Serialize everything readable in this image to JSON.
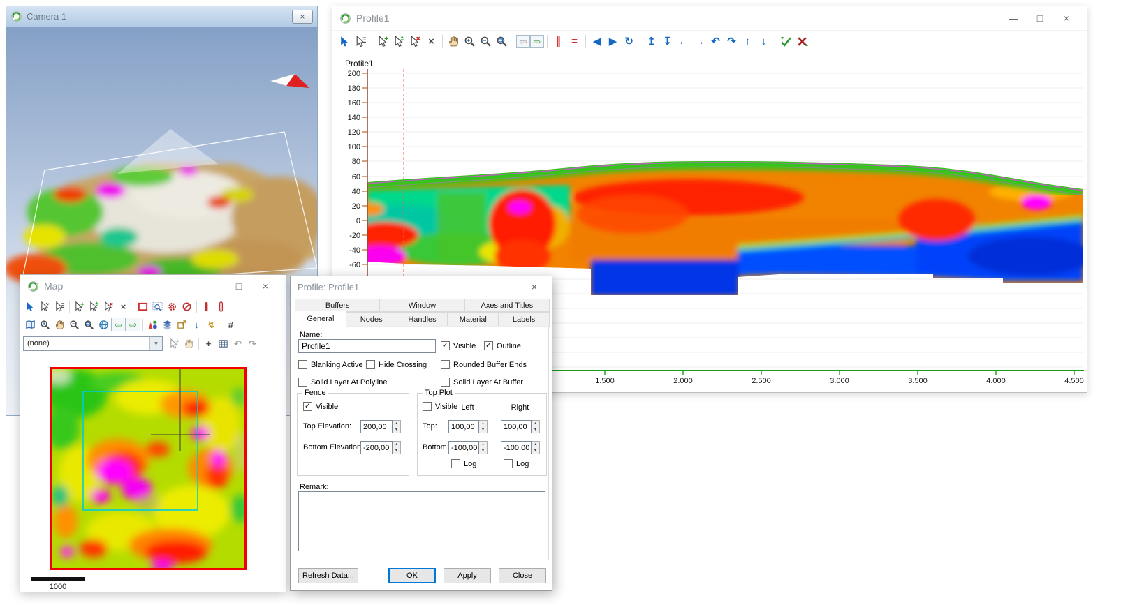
{
  "glyphs": {
    "minimize": "—",
    "maximize": "□",
    "close": "×",
    "check": "✓",
    "dropdown": "▾",
    "spin_up": "▴",
    "spin_down": "▾",
    "arrow_left": "←",
    "arrow_right": "→",
    "arrow_up": "↑",
    "arrow_down": "↓",
    "arrow_top": "↥",
    "arrow_bottom": "↧",
    "undo": "↶",
    "redo": "↷",
    "nav_back": "⇦",
    "nav_forward": "⇨",
    "tri_left": "◀",
    "tri_right": "▶",
    "cross": "×",
    "refresh": "↻",
    "bolt": "↯",
    "vbars": "∥",
    "hbars": "=",
    "grid": "#",
    "plus": "+"
  },
  "camera_window": {
    "title": "Camera 1"
  },
  "profile_window": {
    "title": "Profile1",
    "plot": {
      "title": "Profile1",
      "y_ticks": [
        "200",
        "180",
        "160",
        "140",
        "120",
        "100",
        "80",
        "60",
        "40",
        "20",
        "0",
        "-20",
        "-40",
        "-60"
      ],
      "x_ticks": [
        "1.500",
        "2.000",
        "2.500",
        "3.000",
        "3.500",
        "4.000",
        "4.500"
      ]
    }
  },
  "map_window": {
    "title": "Map",
    "layer_select": "(none)",
    "scale_label": "1000"
  },
  "dialog": {
    "title": "Profile: Profile1",
    "tabs_back": [
      "Buffers",
      "Window",
      "Axes and Titles"
    ],
    "tabs_front": [
      "General",
      "Nodes",
      "Handles",
      "Material",
      "Labels"
    ],
    "name_label": "Name:",
    "name_value": "Profile1",
    "cb_visible": "Visible",
    "cb_outline": "Outline",
    "cb_blanking": "Blanking Active",
    "cb_hide_crossing": "Hide Crossing",
    "cb_rounded": "Rounded Buffer Ends",
    "cb_solid_polyline": "Solid Layer At Polyline",
    "cb_solid_buffer": "Solid Layer At Buffer",
    "fence": {
      "legend": "Fence",
      "visible": "Visible",
      "top_label": "Top Elevation:",
      "top_value": "200,00",
      "bottom_label": "Bottom Elevation:",
      "bottom_value": "-200,00"
    },
    "top_plot": {
      "legend": "Top Plot",
      "visible": "Visible",
      "left": "Left",
      "right": "Right",
      "top_label": "Top:",
      "top_left": "100,00",
      "top_right": "100,00",
      "bottom_label": "Bottom:",
      "bottom_left": "-100,00",
      "bottom_right": "-100,00",
      "log_left": "Log",
      "log_right": "Log"
    },
    "remark_label": "Remark:",
    "buttons": {
      "refresh": "Refresh Data...",
      "ok": "OK",
      "apply": "Apply",
      "close": "Close"
    }
  }
}
